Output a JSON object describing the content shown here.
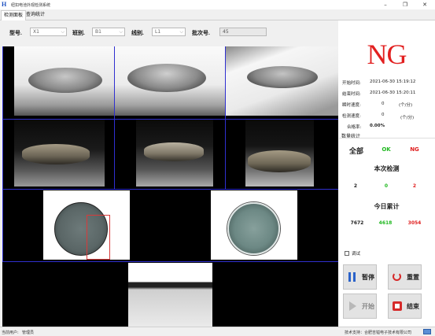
{
  "window": {
    "title": "纽扣电池外观检测系统",
    "logo": "H",
    "minimize": "–",
    "restore": "❐",
    "close": "✕"
  },
  "tabs": [
    {
      "label": "检测面板",
      "active": true
    },
    {
      "label": "查询统计",
      "active": false
    }
  ],
  "toolbar": {
    "model_label": "型号.",
    "model_value": "X1",
    "group_label": "班别.",
    "group_value": "B1",
    "line_label": "线别.",
    "line_value": "L1",
    "batch_label": "批次号.",
    "batch_value": "45"
  },
  "result": {
    "text": "NG",
    "color": "#e22020"
  },
  "info": {
    "start_label": "开始时间:",
    "start_value": "2021-06-30  15:19:12",
    "end_label": "结束时间:",
    "end_value": "2021-06-30  15:20:11",
    "instant_label": "瞬时速度:",
    "instant_value": "0",
    "instant_unit": "(个/分)",
    "detect_label": "检测速度:",
    "detect_value": "0",
    "detect_unit": "(个/分)",
    "pass_label": "合格率:",
    "pass_value": "0.00%"
  },
  "stats": {
    "section_title": "数量统计",
    "all_label": "全部",
    "ok_label": "OK",
    "ng_label": "NG",
    "current_title": "本次检测",
    "current": {
      "all": "2",
      "ok": "0",
      "ng": "2"
    },
    "today_title": "今日累计",
    "today": {
      "all": "7672",
      "ok": "4618",
      "ng": "3054"
    },
    "ok_color": "#1fb81f",
    "ng_color": "#e02020"
  },
  "debug_label": "调试",
  "buttons": {
    "pause": "暂停",
    "reset": "重置",
    "start": "开始",
    "end": "结束"
  },
  "statusbar": {
    "user_label": "当前用户:",
    "user_value": "管理员",
    "support": "技术支持：合肥吉镒电子技术有限公司"
  }
}
